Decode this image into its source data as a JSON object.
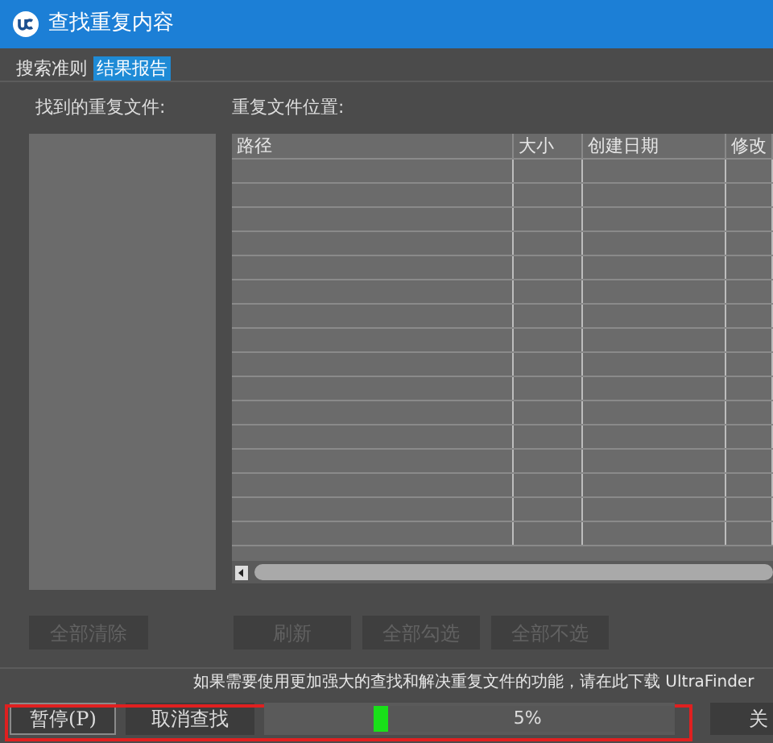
{
  "window": {
    "title": "查找重复内容"
  },
  "tabs": [
    {
      "label": "搜索准则",
      "selected": false
    },
    {
      "label": "结果报告",
      "selected": true
    }
  ],
  "found_files": {
    "label": "找到的重复文件:"
  },
  "locations": {
    "label": "重复文件位置:",
    "columns": [
      "路径",
      "大小",
      "创建日期",
      "修改"
    ]
  },
  "list_buttons": [
    {
      "label": "全部清除",
      "disabled": true
    }
  ],
  "table_buttons": [
    {
      "label": "刷新",
      "disabled": true
    },
    {
      "label": "全部勾选",
      "disabled": true
    },
    {
      "label": "全部不选",
      "disabled": true
    }
  ],
  "hint": "如果需要使用更加强大的查找和解决重复文件的功能，请在此下载 UltraFinder",
  "footer": {
    "pause": "暂停(P)",
    "cancel": "取消查找",
    "progress": {
      "level": 0.05,
      "reading": "5%"
    },
    "close": "关"
  }
}
